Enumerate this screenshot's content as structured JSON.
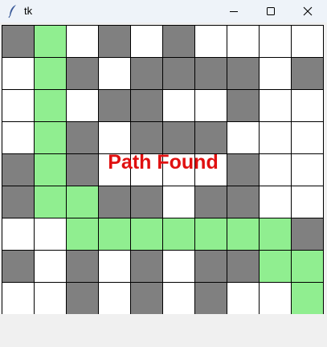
{
  "window": {
    "title": "tk",
    "icon": "feather-icon",
    "controls": [
      "minimize-icon",
      "maximize-icon",
      "close-icon"
    ]
  },
  "canvas": {
    "message": "Path Found",
    "message_color": "#e01010",
    "colors": {
      "open": "#ffffff",
      "wall": "#808080",
      "path": "#90ee90"
    },
    "grid": [
      [
        "wall",
        "path",
        "open",
        "wall",
        "open",
        "wall",
        "open",
        "open",
        "open",
        "open"
      ],
      [
        "open",
        "path",
        "wall",
        "open",
        "wall",
        "wall",
        "wall",
        "wall",
        "open",
        "wall"
      ],
      [
        "open",
        "path",
        "open",
        "wall",
        "wall",
        "open",
        "open",
        "wall",
        "open",
        "open"
      ],
      [
        "open",
        "path",
        "wall",
        "open",
        "wall",
        "wall",
        "wall",
        "open",
        "open",
        "open"
      ],
      [
        "wall",
        "path",
        "wall",
        "open",
        "open",
        "open",
        "open",
        "wall",
        "open",
        "open"
      ],
      [
        "wall",
        "path",
        "path",
        "wall",
        "wall",
        "open",
        "wall",
        "wall",
        "open",
        "open"
      ],
      [
        "open",
        "open",
        "path",
        "path",
        "path",
        "path",
        "path",
        "path",
        "path",
        "wall"
      ],
      [
        "wall",
        "open",
        "wall",
        "open",
        "wall",
        "open",
        "wall",
        "wall",
        "path",
        "path"
      ],
      [
        "open",
        "open",
        "wall",
        "open",
        "wall",
        "open",
        "wall",
        "open",
        "open",
        "path"
      ]
    ]
  }
}
